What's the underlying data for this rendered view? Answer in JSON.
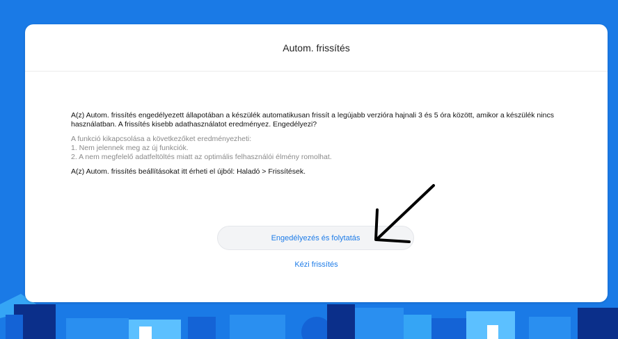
{
  "dialog": {
    "title": "Autom. frissítés",
    "intro": "A(z) Autom. frissítés engedélyezett állapotában a készülék automatikusan frissít a legújabb verzióra hajnali 3 és 5 óra között, amikor a készülék nincs használatban. A frissítés kisebb adathasználatot eredményez. Engedélyezi?",
    "notes": {
      "heading": "A funkció kikapcsolása a következőket eredményezheti:",
      "item1": "1. Nem jelennek meg az új funkciók.",
      "item2": "2. A nem megfelelő adatfeltöltés miatt az optimális felhasználói élmény romolhat."
    },
    "hint": "A(z) Autom. frissítés beállításokat itt érheti el újból: Haladó > Frissítések.",
    "primary_button": "Engedélyezés és folytatás",
    "secondary_link": "Kézi frissítés"
  },
  "colors": {
    "background": "#1a7ae6",
    "accent": "#1e7ce8"
  }
}
